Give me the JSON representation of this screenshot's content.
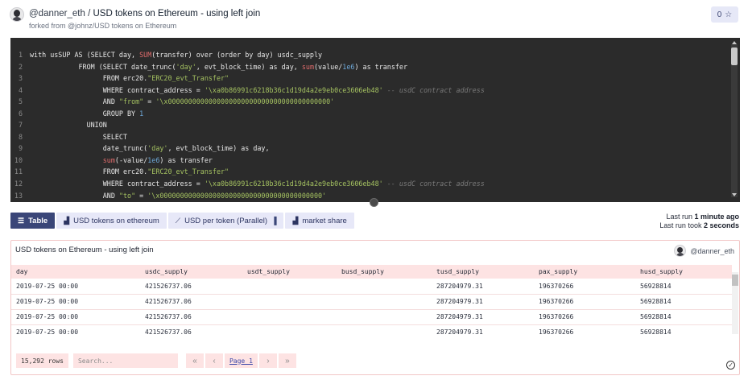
{
  "header": {
    "user": "@danner_eth",
    "separator": "/",
    "query_name": "USD tokens on Ethereum - using left join",
    "forked_prefix": "forked from",
    "forked_link": "@johnz/USD tokens on Ethereum",
    "star_count": "0",
    "star_icon": "☆"
  },
  "editor": {
    "lines": [
      {
        "n": "1",
        "html": "with usSUP AS (SELECT day, <span class=\"fn\">SUM</span>(transfer) over (order by day) usdc_supply"
      },
      {
        "n": "2",
        "html": "            FROM (SELECT date_trunc(<span class=\"str\">'day'</span>, evt_block_time) as day, <span class=\"fn\">sum</span>(value/<span class=\"num2\">1e6</span>) as transfer"
      },
      {
        "n": "3",
        "html": "                  FROM erc20.<span class=\"str\">\"ERC20_evt_Transfer\"</span>"
      },
      {
        "n": "4",
        "html": "                  WHERE contract_address = <span class=\"str\">'\\xa0b86991c6218b36c1d19d4a2e9eb0ce3606eb48'</span> <span class=\"cmt\">-- usdC contract address</span>"
      },
      {
        "n": "5",
        "html": "                  AND <span class=\"str\">\"from\"</span> = <span class=\"str\">'\\x0000000000000000000000000000000000000000'</span>"
      },
      {
        "n": "6",
        "html": "                  GROUP BY <span class=\"num2\">1</span>"
      },
      {
        "n": "7",
        "html": "              UNION"
      },
      {
        "n": "8",
        "html": "                  SELECT"
      },
      {
        "n": "9",
        "html": "                  date_trunc(<span class=\"str\">'day'</span>, evt_block_time) as day,"
      },
      {
        "n": "10",
        "html": "                  <span class=\"fn\">sum</span>(-value/<span class=\"num2\">1e6</span>) as transfer"
      },
      {
        "n": "11",
        "html": "                  FROM erc20.<span class=\"str\">\"ERC20_evt_Transfer\"</span>"
      },
      {
        "n": "12",
        "html": "                  WHERE contract_address = <span class=\"str\">'\\xa0b86991c6218b36c1d19d4a2e9eb0ce3606eb48'</span> <span class=\"cmt\">-- usdC contract address</span>"
      },
      {
        "n": "13",
        "html": "                  AND <span class=\"str\">\"to\"</span> = <span class=\"str\">'\\x0000000000000000000000000000000000000000'</span>"
      }
    ]
  },
  "tabs": [
    {
      "label": "Table",
      "icon": "☰",
      "icon_name": "table-icon",
      "active": true
    },
    {
      "label": "USD tokens on ethereum",
      "icon": "▟",
      "icon_name": "bar-chart-icon",
      "active": false
    },
    {
      "label": "USD per token (Parallel)",
      "icon": "⟋",
      "icon_name": "line-chart-icon",
      "active": false,
      "suffix": "▐"
    },
    {
      "label": "market share",
      "icon": "▟",
      "icon_name": "bar-chart-icon",
      "active": false
    }
  ],
  "run_info": {
    "last_run_prefix": "Last run",
    "last_run_value": "1 minute ago",
    "took_prefix": "Last run took",
    "took_value": "2 seconds"
  },
  "results": {
    "title": "USD tokens on Ethereum - using left join",
    "owner": "@danner_eth",
    "columns": [
      "day",
      "usdc_supply",
      "usdt_supply",
      "busd_supply",
      "tusd_supply",
      "pax_supply",
      "husd_supply"
    ],
    "rows": [
      [
        "2019-07-25 00:00",
        "421526737.06",
        "",
        "",
        "287204979.31",
        "196370266",
        "56928814"
      ],
      [
        "2019-07-25 00:00",
        "421526737.06",
        "",
        "",
        "287204979.31",
        "196370266",
        "56928814"
      ],
      [
        "2019-07-25 00:00",
        "421526737.06",
        "",
        "",
        "287204979.31",
        "196370266",
        "56928814"
      ],
      [
        "2019-07-25 00:00",
        "421526737.06",
        "",
        "",
        "287204979.31",
        "196370266",
        "56928814"
      ]
    ],
    "rows_count": "15,292 rows",
    "search_placeholder": "Search...",
    "page_label": "Page 1",
    "first_icon": "«",
    "prev_icon": "‹",
    "next_icon": "›",
    "last_icon": "»",
    "check_icon": "✓"
  }
}
